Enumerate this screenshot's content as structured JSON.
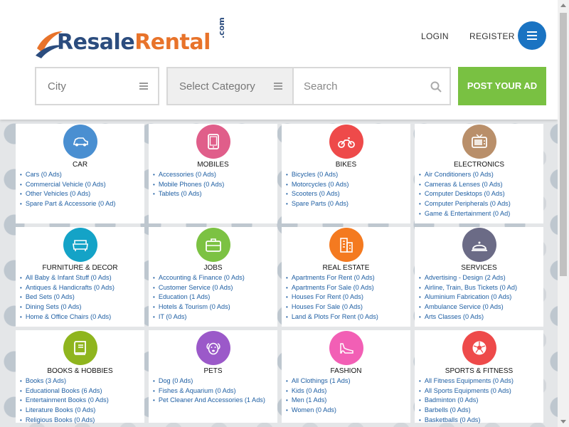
{
  "header": {
    "logo": {
      "part1": "Resale",
      "part2": "Rental",
      "suffix": ".com"
    },
    "nav": {
      "login": "LOGIN",
      "register": "REGISTER"
    },
    "menu_icon": "hamburger-icon"
  },
  "search": {
    "city_placeholder": "City",
    "category_placeholder": "Select Category",
    "search_placeholder": "Search",
    "post_ad_label": "POST YOUR AD"
  },
  "colors": {
    "brand_blue": "#2b4c7e",
    "brand_orange": "#e8732a",
    "post_button": "#79c142",
    "menu_button": "#1a73c2",
    "link": "#1f5fa3"
  },
  "categories": [
    {
      "title": "CAR",
      "icon": "car-icon",
      "color": "#4a8fd1",
      "items": [
        "Cars (0 Ads)",
        "Commercial Vehicle (0 Ads)",
        "Other Vehicles (0 Ads)",
        "Spare Part & Accessorie (0 Ad)"
      ]
    },
    {
      "title": "MOBILES",
      "icon": "tablet-icon",
      "color": "#e05e8a",
      "items": [
        "Accessories (0 Ads)",
        "Mobile Phones (0 Ads)",
        "Tablets (0 Ads)"
      ]
    },
    {
      "title": "BIKES",
      "icon": "motorcycle-icon",
      "color": "#ee4a4a",
      "items": [
        "Bicycles (0 Ads)",
        "Motorcycles (0 Ads)",
        "Scooters (0 Ads)",
        "Spare Parts (0 Ads)"
      ]
    },
    {
      "title": "ELECTRONICS",
      "icon": "tv-icon",
      "color": "#b98f6a",
      "items": [
        "Air Conditioners (0 Ads)",
        "Cameras & Lenses (0 Ads)",
        "Computer Desktops (0 Ads)",
        "Computer Peripherals (0 Ads)",
        "Game & Entertainment (0 Ad)"
      ]
    },
    {
      "title": "FURNITURE & DECOR",
      "icon": "sofa-icon",
      "color": "#14a3c7",
      "items": [
        "All Baby & Infant Stuff (0 Ads)",
        "Antiques & Handicrafts (0 Ads)",
        "Bed Sets (0 Ads)",
        "Dining Sets (0 Ads)",
        "Home & Office Chairs (0 Ads)"
      ]
    },
    {
      "title": "JOBS",
      "icon": "briefcase-icon",
      "color": "#7cc243",
      "items": [
        "Accounting & Finance (0 Ads)",
        "Customer Service (0 Ads)",
        "Education (1 Ads)",
        "Hotels & Tourism (0 Ads)",
        "IT (0 Ads)"
      ]
    },
    {
      "title": "REAL ESTATE",
      "icon": "building-icon",
      "color": "#f47a20",
      "items": [
        "Apartments For Rent (0 Ads)",
        "Apartments For Sale (0 Ads)",
        "Houses For Rent (0 Ads)",
        "Houses For Sale (0 Ads)",
        "Land & Plots For Rent (0 Ads)"
      ]
    },
    {
      "title": "SERVICES",
      "icon": "bell-icon",
      "color": "#6b6b86",
      "items": [
        "Advertising - Design (2 Ads)",
        "Airline, Train, Bus Tickets (0 Ad)",
        "Aluminium Fabrication (0 Ads)",
        "Ambulance Service (0 Ads)",
        "Arts Classes (0 Ads)"
      ]
    },
    {
      "title": "BOOKS & HOBBIES",
      "icon": "book-icon",
      "color": "#8fb51e",
      "items": [
        "Books (3 Ads)",
        "Educational Books (6 Ads)",
        "Entertainment Books (0 Ads)",
        "Literature Books (0 Ads)",
        "Religious Books (0 Ads)"
      ]
    },
    {
      "title": "PETS",
      "icon": "dog-icon",
      "color": "#9b59c9",
      "items": [
        "Dog (0 Ads)",
        "Fishes & Aquarium (0 Ads)",
        "Pet Cleaner And Accessories (1 Ads)"
      ]
    },
    {
      "title": "FASHION",
      "icon": "shoe-icon",
      "color": "#f25fb5",
      "items": [
        "All Clothings (1 Ads)",
        "Kids (0 Ads)",
        "Men (1 Ads)",
        "Women (0 Ads)"
      ]
    },
    {
      "title": "SPORTS & FITNESS",
      "icon": "football-icon",
      "color": "#ee4a4a",
      "items": [
        "All Fitness Equipments (0 Ads)",
        "All Sports Equipments (0 Ads)",
        "Badminton (0 Ads)",
        "Barbells (0 Ads)",
        "Basketballs (0 Ads)"
      ]
    }
  ]
}
